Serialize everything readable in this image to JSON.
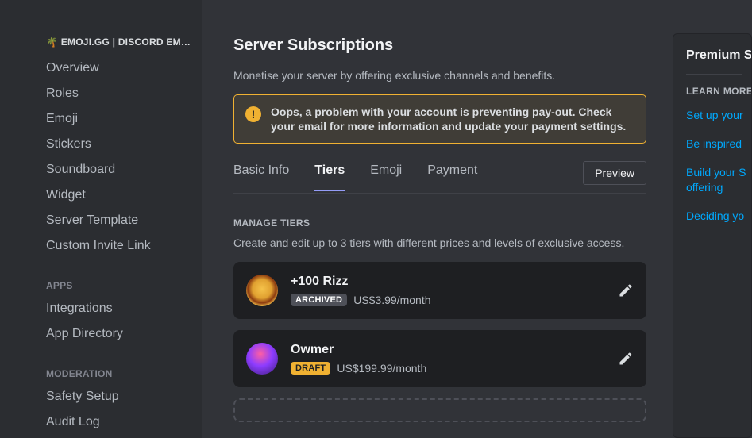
{
  "sidebar": {
    "server_name": "🌴 EMOJI.GG | DISCORD EM…",
    "main_items": [
      "Overview",
      "Roles",
      "Emoji",
      "Stickers",
      "Soundboard",
      "Widget",
      "Server Template",
      "Custom Invite Link"
    ],
    "apps_heading": "APPS",
    "apps_items": [
      "Integrations",
      "App Directory"
    ],
    "mod_heading": "MODERATION",
    "mod_items": [
      "Safety Setup",
      "Audit Log"
    ]
  },
  "page": {
    "title": "Server Subscriptions",
    "subtitle": "Monetise your server by offering exclusive channels and benefits."
  },
  "alert": {
    "text_prefix": "Oops, a problem with your account is preventing pay-out. Check your email for more information and ",
    "text_bold": "update your payment settings."
  },
  "tabs": {
    "items": [
      "Basic Info",
      "Tiers",
      "Emoji",
      "Payment"
    ],
    "active_index": 1,
    "preview_label": "Preview"
  },
  "tiers_section": {
    "heading": "MANAGE TIERS",
    "desc": "Create and edit up to 3 tiers with different prices and levels of exclusive access."
  },
  "tiers": [
    {
      "name": "+100 Rizz",
      "badge": "ARCHIVED",
      "badge_type": "archived",
      "price": "US$3.99/month",
      "avatar": "burger"
    },
    {
      "name": "Owmer",
      "badge": "DRAFT",
      "badge_type": "draft",
      "price": "US$199.99/month",
      "avatar": "orb"
    }
  ],
  "right_panel": {
    "title": "Premium S",
    "heading": "LEARN MORE",
    "links": [
      "Set up your",
      "Be inspired",
      "Build your S\noffering",
      "Deciding yo"
    ]
  }
}
